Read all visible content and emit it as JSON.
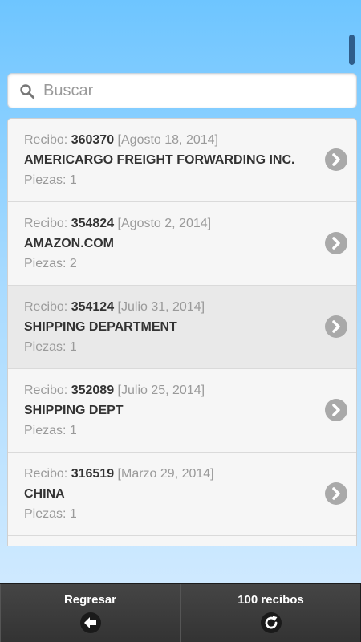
{
  "search": {
    "placeholder": "Buscar",
    "icon": "search-icon"
  },
  "receipt_prefix": "Recibo:",
  "pieces_prefix": "Piezas:",
  "receipts": [
    {
      "number": "360370",
      "date": "[Agosto 18, 2014]",
      "sender": "AMERICARGO FREIGHT FORWARDING INC.",
      "pieces": "1"
    },
    {
      "number": "354824",
      "date": "[Agosto 2, 2014]",
      "sender": "AMAZON.COM",
      "pieces": "2"
    },
    {
      "number": "354124",
      "date": "[Julio 31, 2014]",
      "sender": "SHIPPING DEPARTMENT",
      "pieces": "1"
    },
    {
      "number": "352089",
      "date": "[Julio 25, 2014]",
      "sender": "SHIPPING DEPT",
      "pieces": "1"
    },
    {
      "number": "316519",
      "date": "[Marzo 29, 2014]",
      "sender": "CHINA",
      "pieces": "1"
    }
  ],
  "footer": {
    "back_label": "Regresar",
    "count_label": "100 recibos"
  },
  "colors": {
    "header_gradient_top": "#6ec5ff",
    "footer": "#3b3b3b",
    "chevron": "#a9a9a9"
  }
}
